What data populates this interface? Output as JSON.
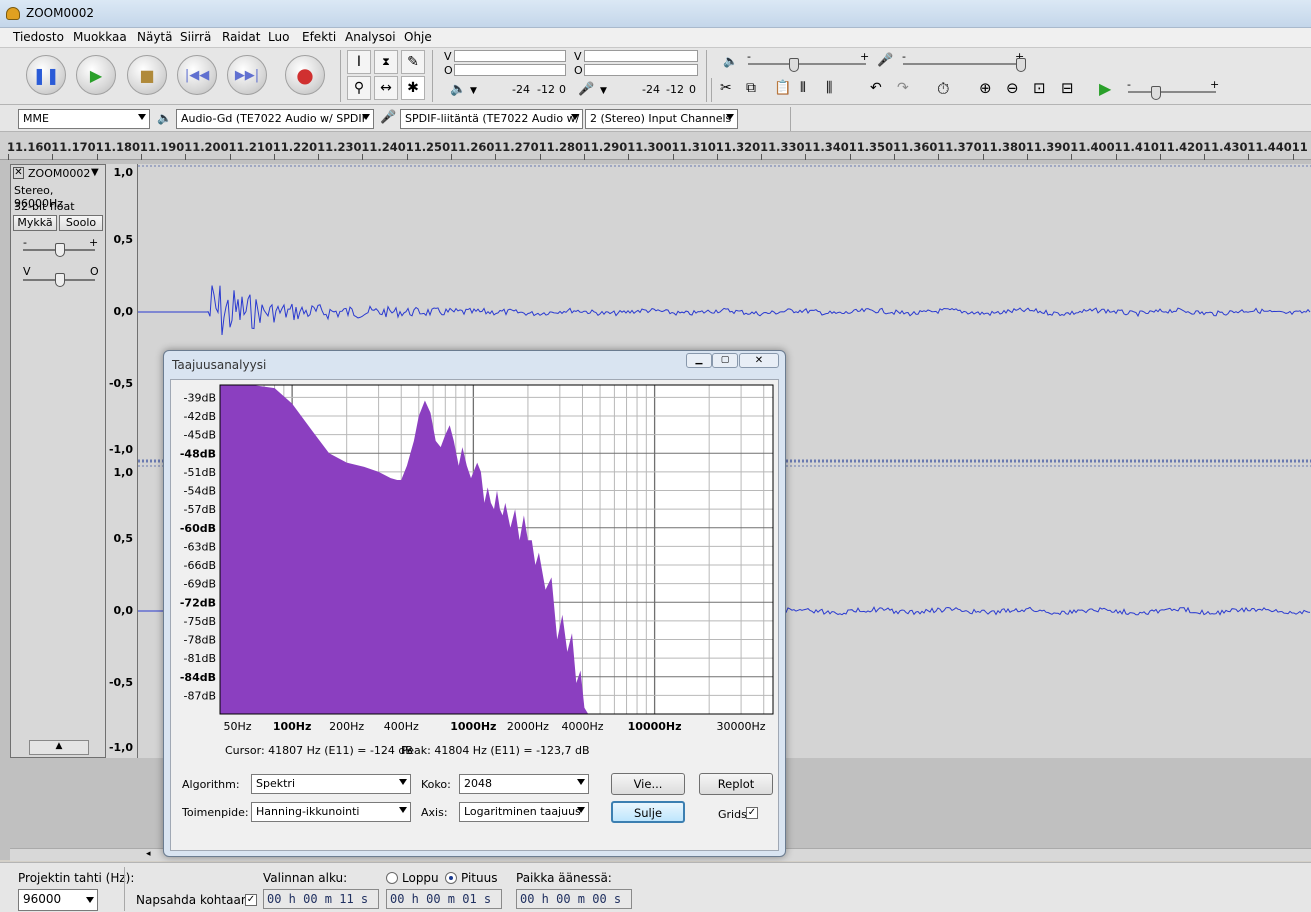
{
  "window": {
    "title": "ZOOM0002"
  },
  "menu": [
    "Tiedosto",
    "Muokkaa",
    "Näytä",
    "Siirrä",
    "Raidat",
    "Luo",
    "Efekti",
    "Analysoi",
    "Ohje"
  ],
  "meters": {
    "play_label": "V",
    "play_label2": "O",
    "rec_label": "V",
    "rec_label2": "O",
    "play_scale": [
      "-24",
      "-12",
      "0"
    ],
    "rec_scale": [
      "-24",
      "-12",
      "0"
    ]
  },
  "mixer": {
    "out_plus": "+",
    "out_minus": "-",
    "in_plus": "+",
    "in_minus": "-",
    "speed_minus": "-",
    "speed_plus": "+"
  },
  "devices": {
    "host": "MME",
    "output": "Audio-Gd (TE7022 Audio w/ SPDIF",
    "input": "SPDIF-liitäntä (TE7022 Audio w/",
    "channels": "2 (Stereo) Input Channels"
  },
  "ruler": [
    "11.160",
    "11.170",
    "11.180",
    "11.190",
    "11.200",
    "11.210",
    "11.220",
    "11.230",
    "11.240",
    "11.250",
    "11.260",
    "11.270",
    "11.280",
    "11.290",
    "11.300",
    "11.310",
    "11.320",
    "11.330",
    "11.340",
    "11.350",
    "11.360",
    "11.370",
    "11.380",
    "11.390",
    "11.400",
    "11.410",
    "11.420",
    "11.430",
    "11.440",
    "11"
  ],
  "track": {
    "name": "ZOOM0002",
    "info1": "Stereo, 96000Hz",
    "info2": "32-bit float",
    "mute": "Mykkä",
    "solo": "Soolo",
    "gain_minus": "-",
    "gain_plus": "+",
    "pan_left": "V",
    "pan_right": "O",
    "scale_top": [
      "1,0",
      "0,5",
      "0,0",
      "-0,5",
      "-1,0"
    ],
    "scale_bottom": [
      "1,0",
      "0,5",
      "0,0",
      "-0,5",
      "-1,0"
    ]
  },
  "dialog": {
    "title": "Taajuusanalyysi",
    "cursor": "Cursor: 41807 Hz (E11) = -124 dB",
    "peak": "Peak: 41804 Hz (E11) = -123,7 dB",
    "algorithm_label": "Algorithm:",
    "algorithm": "Spektri",
    "size_label": "Koko:",
    "size": "2048",
    "function_label": "Toimenpide:",
    "function": "Hanning-ikkunointi",
    "axis_label": "Axis:",
    "axis": "Logaritminen taajuus",
    "export_button": "Vie...",
    "replot_button": "Replot",
    "close_button": "Sulje",
    "grids_label": "Grids",
    "grids_checked": "✓"
  },
  "chart_data": {
    "type": "area",
    "x_scale": "log",
    "xlim": [
      40,
      45000
    ],
    "ylim": [
      -90,
      -37
    ],
    "fill_color": "#8b3fc0",
    "y_ticks": [
      "-39dB",
      "-42dB",
      "-45dB",
      "-48dB",
      "-51dB",
      "-54dB",
      "-57dB",
      "-60dB",
      "-63dB",
      "-66dB",
      "-69dB",
      "-72dB",
      "-75dB",
      "-78dB",
      "-81dB",
      "-84dB",
      "-87dB"
    ],
    "y_ticks_bold": [
      "-48dB",
      "-60dB",
      "-72dB",
      "-84dB"
    ],
    "x_ticks": [
      {
        "label": "50Hz",
        "hz": 50,
        "bold": false
      },
      {
        "label": "100Hz",
        "hz": 100,
        "bold": true
      },
      {
        "label": "200Hz",
        "hz": 200,
        "bold": false
      },
      {
        "label": "400Hz",
        "hz": 400,
        "bold": false
      },
      {
        "label": "1000Hz",
        "hz": 1000,
        "bold": true
      },
      {
        "label": "2000Hz",
        "hz": 2000,
        "bold": false
      },
      {
        "label": "4000Hz",
        "hz": 4000,
        "bold": false
      },
      {
        "label": "10000Hz",
        "hz": 10000,
        "bold": true
      },
      {
        "label": "30000Hz",
        "hz": 30000,
        "bold": false
      }
    ],
    "x": [
      40,
      60,
      80,
      100,
      130,
      160,
      200,
      250,
      300,
      350,
      380,
      400,
      430,
      470,
      500,
      540,
      580,
      620,
      660,
      700,
      740,
      780,
      830,
      870,
      920,
      970,
      1050,
      1100,
      1150,
      1200,
      1250,
      1300,
      1350,
      1400,
      1450,
      1500,
      1600,
      1700,
      1800,
      1900,
      2000,
      2100,
      2200,
      2300,
      2500,
      2700,
      2900,
      3100,
      3300,
      3500,
      3700,
      3900,
      4100,
      4300
    ],
    "values": [
      -37,
      -37,
      -37.5,
      -40,
      -44.5,
      -48,
      -49.5,
      -50.2,
      -51,
      -52,
      -52.3,
      -52.3,
      -50,
      -46,
      -42,
      -39.5,
      -41.5,
      -46,
      -47,
      -45,
      -43.5,
      -46,
      -50,
      -47,
      -50,
      -52,
      -49.5,
      -51,
      -56,
      -53.5,
      -56,
      -57,
      -54,
      -57,
      -58,
      -56,
      -60,
      -57,
      -62,
      -58,
      -62,
      -62,
      -66,
      -64,
      -70,
      -68,
      -78,
      -74,
      -80,
      -77,
      -85,
      -83,
      -89,
      -90
    ]
  },
  "status": {
    "rate_label": "Projektin tahti (Hz):",
    "rate": "96000",
    "snap_label": "Napsahda kohtaan",
    "snap_checked": "✓",
    "sel_start_label": "Valinnan alku:",
    "end_label": "Loppu",
    "length_label": "Pituus",
    "pos_label": "Paikka äänessä:",
    "sel_start": "00 h 00 m 11 s",
    "sel_length": "00 h 00 m 01 s",
    "position": "00 h 00 m 00 s"
  }
}
